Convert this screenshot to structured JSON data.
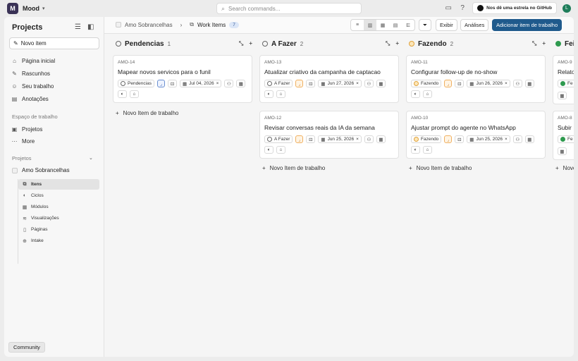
{
  "app": {
    "name": "Mood",
    "logo": "M"
  },
  "search": {
    "placeholder": "Search commands..."
  },
  "topbar": {
    "github_label": "Nos dê uma estrela no GitHub",
    "avatar_initial": "L"
  },
  "sidebar": {
    "title": "Projects",
    "new_item": "Novo item",
    "nav": [
      {
        "label": "Página inicial",
        "icon": "home-icon"
      },
      {
        "label": "Rascunhos",
        "icon": "pencil-icon"
      },
      {
        "label": "Seu trabalho",
        "icon": "user-icon"
      },
      {
        "label": "Anotações",
        "icon": "note-icon"
      }
    ],
    "workspace_label": "Espaço de trabalho",
    "workspace": [
      {
        "label": "Projetos",
        "icon": "briefcase-icon"
      },
      {
        "label": "More",
        "icon": "more-icon"
      }
    ],
    "projects_label": "Projetos",
    "project_name": "Amo Sobrancelhas",
    "project_sub": [
      {
        "label": "Itens",
        "icon": "layers-icon"
      },
      {
        "label": "Ciclos",
        "icon": "cycle-icon"
      },
      {
        "label": "Módulos",
        "icon": "module-icon"
      },
      {
        "label": "Visualizações",
        "icon": "stack-icon"
      },
      {
        "label": "Páginas",
        "icon": "page-icon"
      },
      {
        "label": "Intake",
        "icon": "intake-icon"
      }
    ],
    "community": "Community"
  },
  "header": {
    "project": "Amo Sobrancelhas",
    "page": "Work Items",
    "count": "7",
    "display": "Exibir",
    "analytics": "Análises",
    "add": "Adicionar item de trabalho"
  },
  "board": {
    "new_item_label": "Novo Item de trabalho",
    "columns": [
      {
        "name": "Pendencias",
        "count": "1",
        "state": "todo",
        "cards": [
          {
            "id": "AMO-14",
            "title": "Mapear novos servicos para o funil",
            "state": "Pendencias",
            "date": "Jul 04, 2026",
            "priority": "none"
          }
        ]
      },
      {
        "name": "A Fazer",
        "count": "2",
        "state": "todo",
        "cards": [
          {
            "id": "AMO-13",
            "title": "Atualizar criativo da campanha de captacao",
            "state": "A Fazer",
            "date": "Jun 27, 2026",
            "priority": "med"
          },
          {
            "id": "AMO-12",
            "title": "Revisar conversas reais da IA da semana",
            "state": "A Fazer",
            "date": "Jun 25, 2026",
            "priority": "med"
          }
        ]
      },
      {
        "name": "Fazendo",
        "count": "2",
        "state": "doing",
        "cards": [
          {
            "id": "AMO-11",
            "title": "Configurar follow-up de no-show",
            "state": "Fazendo",
            "date": "Jun 26, 2026",
            "priority": "med"
          },
          {
            "id": "AMO-10",
            "title": "Ajustar prompt do agente no WhatsApp",
            "state": "Fazendo",
            "date": "Jun 25, 2026",
            "priority": "med"
          }
        ]
      },
      {
        "name": "Feit",
        "count": "",
        "state": "done",
        "cards": [
          {
            "id": "AMO-9",
            "title": "Relato",
            "state": "Fe",
            "date": "",
            "priority": ""
          },
          {
            "id": "AMO-8",
            "title": "Subir",
            "state": "Fe",
            "date": "",
            "priority": ""
          }
        ]
      }
    ]
  }
}
